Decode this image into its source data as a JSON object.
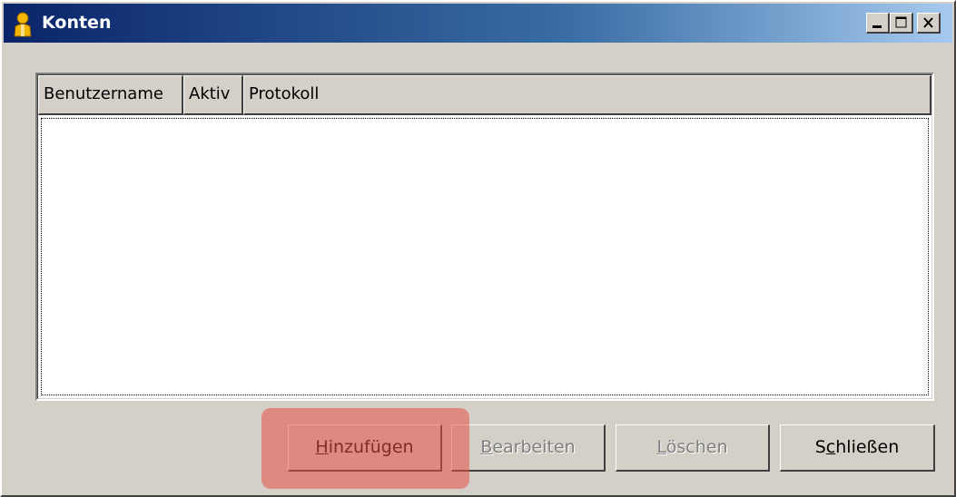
{
  "window": {
    "title": "Konten",
    "icon": "user-account-icon",
    "controls": {
      "minimize": "minimize-icon",
      "maximize": "maximize-icon",
      "close": "close-icon"
    }
  },
  "list": {
    "columns": [
      "Benutzername",
      "Aktiv",
      "Protokoll"
    ],
    "rows": []
  },
  "buttons": {
    "add": {
      "label": "Hinzufügen",
      "mnemonic": "H",
      "enabled": true
    },
    "edit": {
      "label": "Bearbeiten",
      "mnemonic": "B",
      "enabled": false
    },
    "delete": {
      "label": "Löschen",
      "mnemonic": "L",
      "enabled": false
    },
    "close": {
      "label": "Schließen",
      "mnemonic": "c",
      "enabled": true
    }
  },
  "colors": {
    "titlebar_start": "#0a246a",
    "titlebar_end": "#a6caf0",
    "dialog_bg": "#d4d0c8",
    "highlight": "#e65046"
  }
}
